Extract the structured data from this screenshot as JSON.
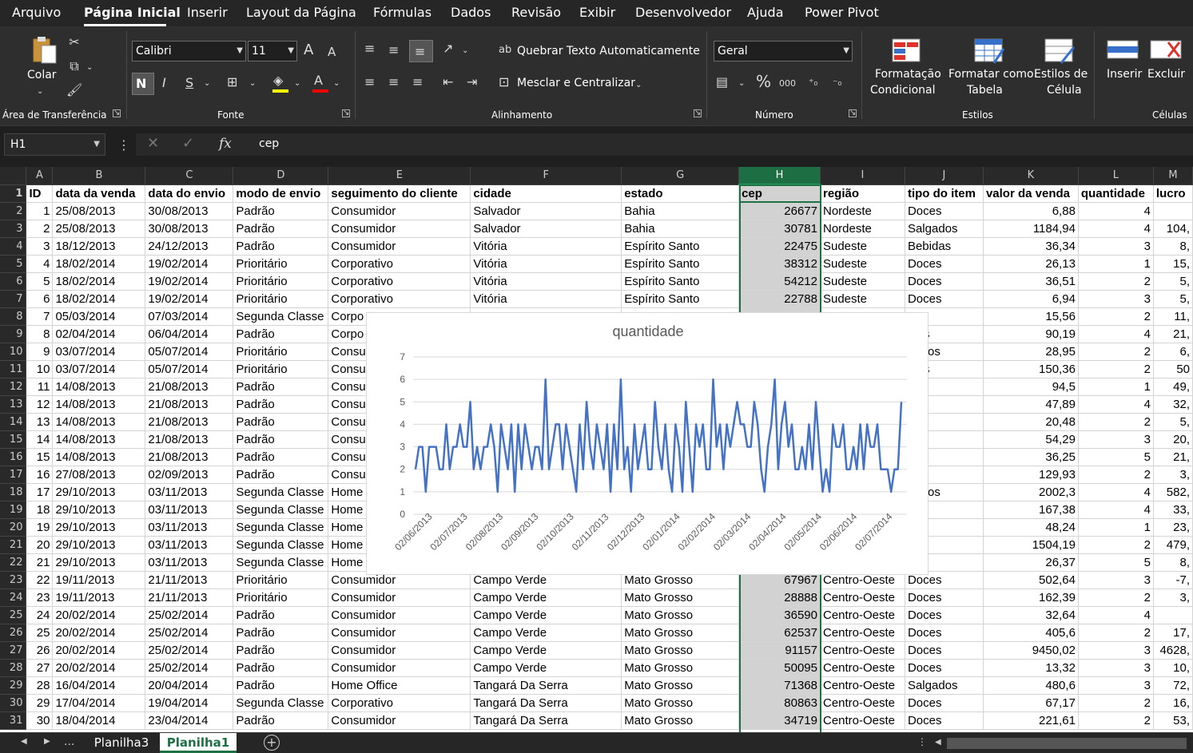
{
  "menu": {
    "items": [
      "Arquivo",
      "Página Inicial",
      "Inserir",
      "Layout da Página",
      "Fórmulas",
      "Dados",
      "Revisão",
      "Exibir",
      "Desenvolvedor",
      "Ajuda",
      "Power Pivot"
    ]
  },
  "ribbon": {
    "clipboard": {
      "paste_label": "Colar",
      "group_label": "Área de Transferência"
    },
    "font": {
      "name": "Calibri",
      "size": "11",
      "bold": "N",
      "italic": "I",
      "underline": "S",
      "color_a": "A",
      "grow": "A",
      "shrink": "A",
      "group_label": "Fonte"
    },
    "alignment": {
      "wrap_label": "Quebrar Texto Automaticamente",
      "merge_label": "Mesclar e Centralizar",
      "group_label": "Alinhamento"
    },
    "number": {
      "format": "Geral",
      "percent": "%",
      "thousands": "000",
      "group_label": "Número"
    },
    "styles": {
      "cond_format_1": "Formatação",
      "cond_format_2": "Condicional",
      "table_format_1": "Formatar como",
      "table_format_2": "Tabela",
      "cell_styles_1": "Estilos de",
      "cell_styles_2": "Célula",
      "group_label": "Estilos"
    },
    "cells": {
      "insert": "Inserir",
      "delete": "Excluir",
      "group_label": "Células"
    }
  },
  "formula_bar": {
    "name_box": "H1",
    "fx": "fx",
    "content": "cep"
  },
  "grid": {
    "columns": [
      "A",
      "B",
      "C",
      "D",
      "E",
      "F",
      "G",
      "H",
      "I",
      "J",
      "K",
      "L",
      "M"
    ],
    "headers": [
      "ID",
      "data da venda",
      "data do envio",
      "modo de envio",
      "seguimento do cliente",
      "cidade",
      "estado",
      "cep",
      "região",
      "tipo do item",
      "valor da venda",
      "quantidade",
      "lucro"
    ],
    "rows": [
      [
        "1",
        "25/08/2013",
        "30/08/2013",
        "Padrão",
        "Consumidor",
        "Salvador",
        "Bahia",
        "26677",
        "Nordeste",
        "Doces",
        "6,88",
        "4",
        ""
      ],
      [
        "2",
        "25/08/2013",
        "30/08/2013",
        "Padrão",
        "Consumidor",
        "Salvador",
        "Bahia",
        "30781",
        "Nordeste",
        "Salgados",
        "1184,94",
        "4",
        "104,"
      ],
      [
        "3",
        "18/12/2013",
        "24/12/2013",
        "Padrão",
        "Consumidor",
        "Vitória",
        "Espírito Santo",
        "22475",
        "Sudeste",
        "Bebidas",
        "36,34",
        "3",
        "8,"
      ],
      [
        "4",
        "18/02/2014",
        "19/02/2014",
        "Prioritário",
        "Corporativo",
        "Vitória",
        "Espírito Santo",
        "38312",
        "Sudeste",
        "Doces",
        "26,13",
        "1",
        "15,"
      ],
      [
        "5",
        "18/02/2014",
        "19/02/2014",
        "Prioritário",
        "Corporativo",
        "Vitória",
        "Espírito Santo",
        "54212",
        "Sudeste",
        "Doces",
        "36,51",
        "2",
        "5,"
      ],
      [
        "6",
        "18/02/2014",
        "19/02/2014",
        "Prioritário",
        "Corporativo",
        "Vitória",
        "Espírito Santo",
        "22788",
        "Sudeste",
        "Doces",
        "6,94",
        "3",
        "5,"
      ],
      [
        "7",
        "05/03/2014",
        "07/03/2014",
        "Segunda Classe",
        "Corpo",
        "",
        "",
        "",
        "",
        "es",
        "15,56",
        "2",
        "11,"
      ],
      [
        "8",
        "02/04/2014",
        "06/04/2014",
        "Padrão",
        "Corpo",
        "",
        "",
        "",
        "",
        "idas",
        "90,19",
        "4",
        "21,"
      ],
      [
        "9",
        "03/07/2014",
        "05/07/2014",
        "Prioritário",
        "Consu",
        "",
        "",
        "",
        "",
        "gados",
        "28,95",
        "2",
        "6,"
      ],
      [
        "10",
        "03/07/2014",
        "05/07/2014",
        "Prioritário",
        "Consu",
        "",
        "",
        "",
        "",
        "idas",
        "150,36",
        "2",
        "50"
      ],
      [
        "11",
        "14/08/2013",
        "21/08/2013",
        "Padrão",
        "Consu",
        "",
        "",
        "",
        "",
        "es",
        "94,5",
        "1",
        "49,"
      ],
      [
        "12",
        "14/08/2013",
        "21/08/2013",
        "Padrão",
        "Consu",
        "",
        "",
        "",
        "",
        "es",
        "47,89",
        "4",
        "32,"
      ],
      [
        "13",
        "14/08/2013",
        "21/08/2013",
        "Padrão",
        "Consu",
        "",
        "",
        "",
        "",
        "es",
        "20,48",
        "2",
        "5,"
      ],
      [
        "14",
        "14/08/2013",
        "21/08/2013",
        "Padrão",
        "Consu",
        "",
        "",
        "",
        "",
        "es",
        "54,29",
        "3",
        "20,"
      ],
      [
        "15",
        "14/08/2013",
        "21/08/2013",
        "Padrão",
        "Consu",
        "",
        "",
        "",
        "",
        "es",
        "36,25",
        "5",
        "21,"
      ],
      [
        "16",
        "27/08/2013",
        "02/09/2013",
        "Padrão",
        "Consu",
        "",
        "",
        "",
        "",
        "es",
        "129,93",
        "2",
        "3,"
      ],
      [
        "17",
        "29/10/2013",
        "03/11/2013",
        "Segunda Classe",
        "Home",
        "",
        "",
        "",
        "",
        "gados",
        "2002,3",
        "4",
        "582,"
      ],
      [
        "18",
        "29/10/2013",
        "03/11/2013",
        "Segunda Classe",
        "Home",
        "",
        "",
        "",
        "",
        "es",
        "167,38",
        "4",
        "33,"
      ],
      [
        "19",
        "29/10/2013",
        "03/11/2013",
        "Segunda Classe",
        "Home",
        "",
        "",
        "",
        "",
        "es",
        "48,24",
        "1",
        "23,"
      ],
      [
        "20",
        "29/10/2013",
        "03/11/2013",
        "Segunda Classe",
        "Home",
        "",
        "",
        "",
        "",
        "es",
        "1504,19",
        "2",
        "479,"
      ],
      [
        "21",
        "29/10/2013",
        "03/11/2013",
        "Segunda Classe",
        "Home",
        "",
        "",
        "",
        "",
        "es",
        "26,37",
        "5",
        "8,"
      ],
      [
        "22",
        "19/11/2013",
        "21/11/2013",
        "Prioritário",
        "Consumidor",
        "Campo Verde",
        "Mato Grosso",
        "67967",
        "Centro-Oeste",
        "Doces",
        "502,64",
        "3",
        "-7,"
      ],
      [
        "23",
        "19/11/2013",
        "21/11/2013",
        "Prioritário",
        "Consumidor",
        "Campo Verde",
        "Mato Grosso",
        "28888",
        "Centro-Oeste",
        "Doces",
        "162,39",
        "2",
        "3,"
      ],
      [
        "24",
        "20/02/2014",
        "25/02/2014",
        "Padrão",
        "Consumidor",
        "Campo Verde",
        "Mato Grosso",
        "36590",
        "Centro-Oeste",
        "Doces",
        "32,64",
        "4",
        ""
      ],
      [
        "25",
        "20/02/2014",
        "25/02/2014",
        "Padrão",
        "Consumidor",
        "Campo Verde",
        "Mato Grosso",
        "62537",
        "Centro-Oeste",
        "Doces",
        "405,6",
        "2",
        "17,"
      ],
      [
        "26",
        "20/02/2014",
        "25/02/2014",
        "Padrão",
        "Consumidor",
        "Campo Verde",
        "Mato Grosso",
        "91157",
        "Centro-Oeste",
        "Doces",
        "9450,02",
        "3",
        "4628,"
      ],
      [
        "27",
        "20/02/2014",
        "25/02/2014",
        "Padrão",
        "Consumidor",
        "Campo Verde",
        "Mato Grosso",
        "50095",
        "Centro-Oeste",
        "Doces",
        "13,32",
        "3",
        "10,"
      ],
      [
        "28",
        "16/04/2014",
        "20/04/2014",
        "Padrão",
        "Home Office",
        "Tangará Da Serra",
        "Mato Grosso",
        "71368",
        "Centro-Oeste",
        "Salgados",
        "480,6",
        "3",
        "72,"
      ],
      [
        "29",
        "17/04/2014",
        "19/04/2014",
        "Segunda Classe",
        "Corporativo",
        "Tangará Da Serra",
        "Mato Grosso",
        "80863",
        "Centro-Oeste",
        "Doces",
        "67,17",
        "2",
        "16,"
      ],
      [
        "30",
        "18/04/2014",
        "23/04/2014",
        "Padrão",
        "Consumidor",
        "Tangará Da Serra",
        "Mato Grosso",
        "34719",
        "Centro-Oeste",
        "Doces",
        "221,61",
        "2",
        "53,"
      ]
    ]
  },
  "chart_data": {
    "type": "line",
    "title": "quantidade",
    "ylim": [
      0,
      7
    ],
    "y_ticks": [
      "0",
      "1",
      "2",
      "3",
      "4",
      "5",
      "6",
      "7"
    ],
    "x_tick_labels": [
      "02/06/2013",
      "02/07/2013",
      "02/08/2013",
      "02/09/2013",
      "02/10/2013",
      "02/11/2013",
      "02/12/2013",
      "02/01/2014",
      "02/02/2014",
      "02/03/2014",
      "02/04/2014",
      "02/05/2014",
      "02/06/2014",
      "02/07/2014"
    ],
    "series": [
      {
        "values": [
          2,
          3,
          3,
          1,
          3,
          3,
          3,
          2,
          2,
          4,
          2,
          3,
          3,
          4,
          3,
          3,
          5,
          2,
          3,
          2,
          3,
          3,
          4,
          3,
          1,
          4,
          3,
          2,
          4,
          1,
          4,
          2,
          4,
          3,
          2,
          3,
          3,
          2,
          6,
          2,
          3,
          4,
          4,
          2,
          4,
          3,
          2,
          1,
          4,
          2,
          5,
          3,
          2,
          4,
          3,
          2,
          4,
          1,
          4,
          2,
          6,
          2,
          3,
          1,
          4,
          2,
          3,
          4,
          2,
          2,
          5,
          3,
          2,
          4,
          2,
          1,
          4,
          3,
          1,
          5,
          3,
          1,
          4,
          3,
          4,
          2,
          2,
          6,
          3,
          4,
          2,
          4,
          3,
          4,
          5,
          4,
          4,
          3,
          3,
          5,
          4,
          2,
          1,
          3,
          4,
          6,
          2,
          4,
          5,
          3,
          4,
          2,
          2,
          3,
          2,
          4,
          2,
          5,
          3,
          1,
          2,
          1,
          4,
          3,
          3,
          4,
          2,
          2,
          3,
          2,
          4,
          2,
          4,
          3,
          3,
          4,
          2,
          2,
          2,
          1,
          2,
          2,
          5
        ]
      }
    ]
  },
  "tabs": {
    "items": [
      "Planilha3",
      "Planilha1"
    ],
    "active": "Planilha1",
    "ellipsis": "...",
    "add": "+"
  },
  "colors": {
    "accent": "#1e7145",
    "line": "#4472c4"
  }
}
